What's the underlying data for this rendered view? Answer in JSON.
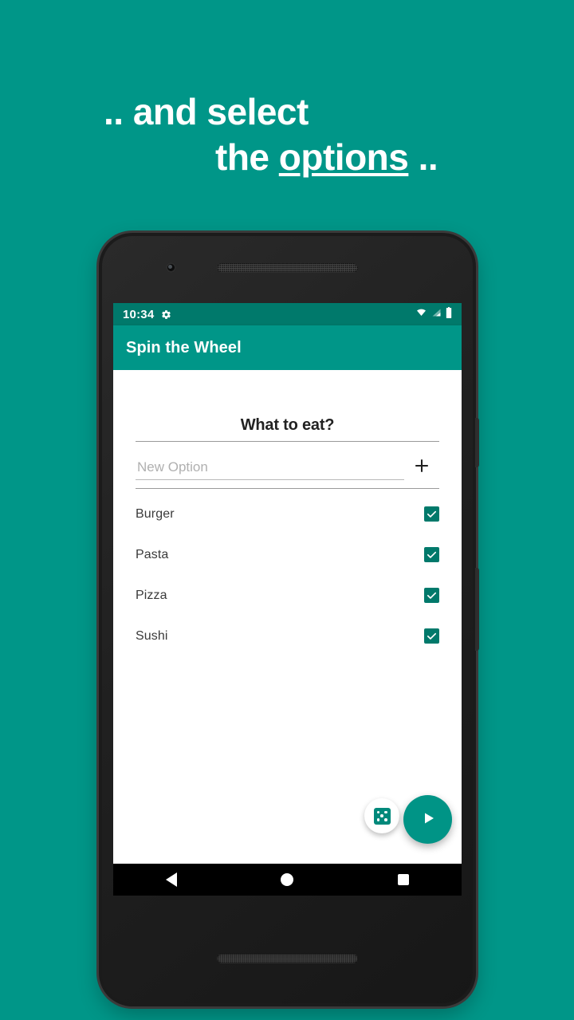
{
  "promo": {
    "line1": ".. and select",
    "line2_pre": "the ",
    "line2_underlined": "options",
    "line2_post": " .."
  },
  "colors": {
    "background_teal": "#009688",
    "status_bar_teal": "#00796B",
    "app_bar_teal": "#009688",
    "checkbox_teal": "#00796B",
    "fab_teal": "#009486",
    "dice_teal": "#00897B"
  },
  "phone": {
    "status_bar": {
      "time": "10:34",
      "gear_icon": "gear-icon",
      "wifi_icon": "wifi-icon",
      "signal_icon": "signal-icon",
      "battery_icon": "battery-icon"
    },
    "app_bar": {
      "title": "Spin the Wheel"
    },
    "content": {
      "list_title": "What to eat?",
      "new_option": {
        "value": "",
        "placeholder": "New Option",
        "add_icon": "plus-icon",
        "add_label": "+"
      },
      "options": [
        {
          "label": "Burger",
          "checked": true
        },
        {
          "label": "Pasta",
          "checked": true
        },
        {
          "label": "Pizza",
          "checked": true
        },
        {
          "label": "Sushi",
          "checked": true
        }
      ],
      "fabs": {
        "dice_icon": "dice-icon",
        "spin_icon": "play-icon"
      }
    },
    "nav_bar": {
      "back_icon": "back-triangle-icon",
      "home_icon": "home-circle-icon",
      "recents_icon": "recents-square-icon"
    }
  }
}
